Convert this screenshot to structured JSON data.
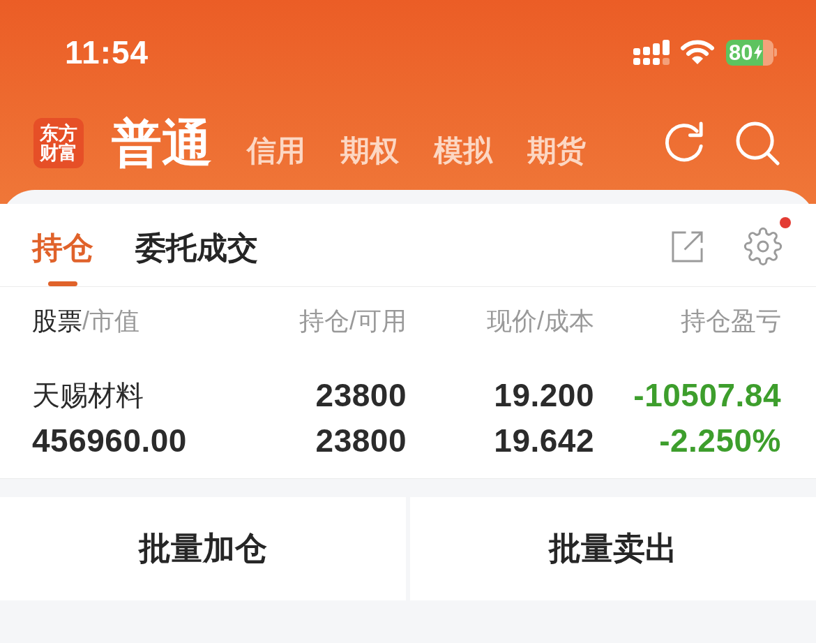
{
  "status_bar": {
    "time": "11:54",
    "battery": "80"
  },
  "account_tabs": {
    "logo": "东方财富",
    "tabs": [
      {
        "label": "普通",
        "selected": true
      },
      {
        "label": "信用",
        "selected": false
      },
      {
        "label": "期权",
        "selected": false
      },
      {
        "label": "模拟",
        "selected": false
      },
      {
        "label": "期货",
        "selected": false
      }
    ]
  },
  "view_tabs": {
    "tabs": [
      {
        "label": "持仓",
        "selected": true
      },
      {
        "label": "委托成交",
        "selected": false
      }
    ],
    "settings_badge": true
  },
  "table": {
    "columns": [
      {
        "label": "股票",
        "note": "/市值",
        "emphasized": true
      },
      {
        "label": "持仓/可用",
        "emphasized": false
      },
      {
        "label": "现价/成本",
        "emphasized": false
      },
      {
        "label": "持仓盈亏",
        "emphasized": false
      }
    ],
    "rows": [
      {
        "name": "天赐材料",
        "market_value": "456960.00",
        "quantity": "23800",
        "available": "23800",
        "price": "19.200",
        "cost": "19.642",
        "pnl": "-10507.84",
        "pnl_percent": "-2.250%",
        "loss": true
      }
    ]
  },
  "buttons": [
    {
      "label": "批量加仓"
    },
    {
      "label": "批量卖出"
    }
  ]
}
